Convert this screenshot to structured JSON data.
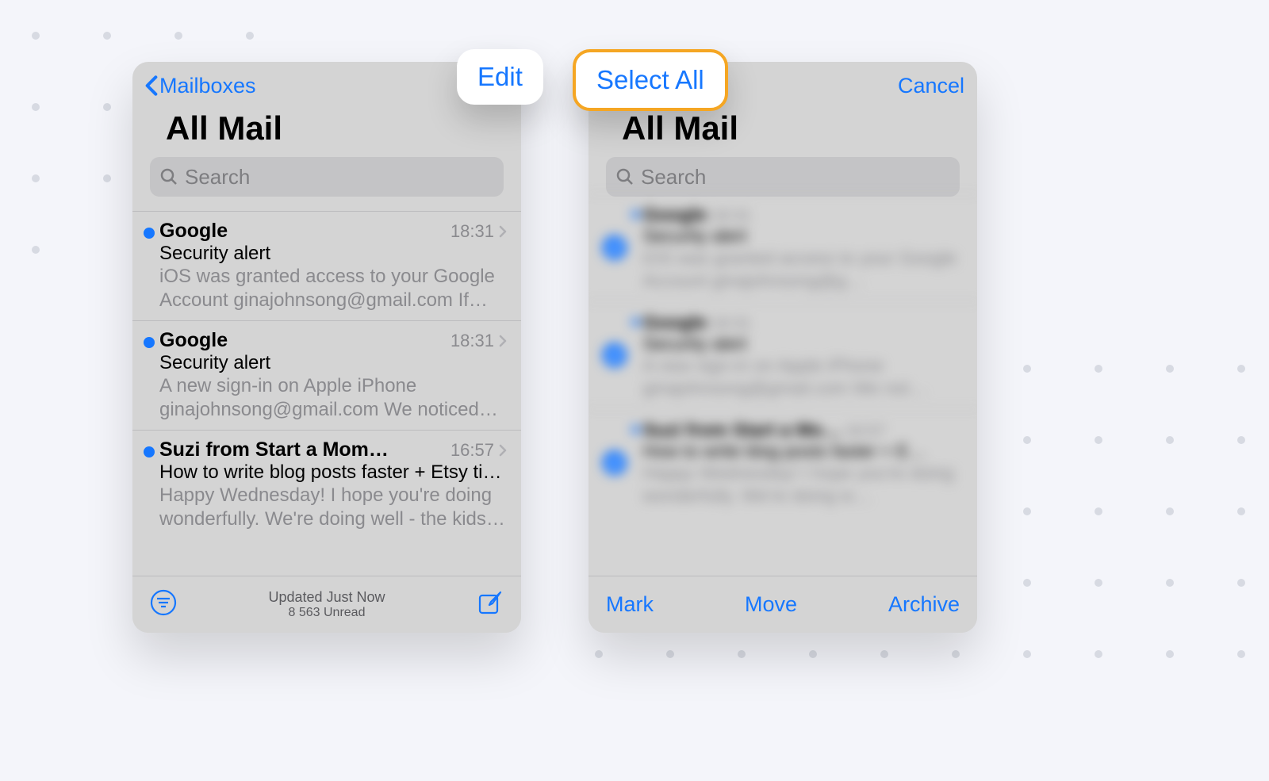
{
  "left": {
    "back_label": "Mailboxes",
    "title": "All Mail",
    "search_placeholder": "Search",
    "emails": [
      {
        "sender": "Google",
        "time": "18:31",
        "subject": "Security alert",
        "preview": "iOS was granted access to your Google Account ginajohnsong@gmail.com If yo…"
      },
      {
        "sender": "Google",
        "time": "18:31",
        "subject": "Security alert",
        "preview": "A new sign-in on Apple iPhone ginajohnsong@gmail.com We noticed a…"
      },
      {
        "sender": "Suzi from Start a Mom…",
        "time": "16:57",
        "subject": "How to write blog posts faster + Etsy ti…",
        "preview": "Happy Wednesday! I hope you're doing wonderfully. We're doing well - the kids…"
      }
    ],
    "status_line": "Updated Just Now",
    "unread_line": "8 563 Unread"
  },
  "right": {
    "cancel_label": "Cancel",
    "title": "All Mail",
    "search_placeholder": "Search",
    "emails": [
      {
        "sender": "Google",
        "time": "18:31",
        "subject": "Security alert",
        "preview": "iOS was granted access to your Google Account ginajohnsong@g…"
      },
      {
        "sender": "Google",
        "time": "18:31",
        "subject": "Security alert",
        "preview": "A new sign-in on Apple iPhone ginajohnsong@gmail.com We not…"
      },
      {
        "sender": "Suzi from Start a Mo…",
        "time": "16:57",
        "subject": "How to write blog posts faster + E…",
        "preview": "Happy Wednesday! I hope you're doing wonderfully. We're doing w…"
      }
    ],
    "mark_label": "Mark",
    "move_label": "Move",
    "archive_label": "Archive"
  },
  "floating": {
    "edit_label": "Edit",
    "select_all_label": "Select All"
  }
}
